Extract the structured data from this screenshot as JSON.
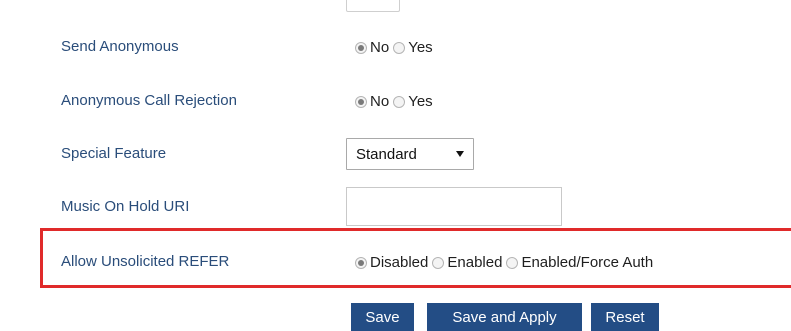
{
  "rows": {
    "send_anonymous": {
      "label": "Send Anonymous",
      "options": [
        "No",
        "Yes"
      ],
      "selected": "No"
    },
    "anonymous_call_rejection": {
      "label": "Anonymous Call Rejection",
      "options": [
        "No",
        "Yes"
      ],
      "selected": "No"
    },
    "special_feature": {
      "label": "Special Feature",
      "value": "Standard"
    },
    "music_on_hold_uri": {
      "label": "Music On Hold URI",
      "value": ""
    },
    "allow_unsolicited_refer": {
      "label": "Allow Unsolicited REFER",
      "options": [
        "Disabled",
        "Enabled",
        "Enabled/Force Auth"
      ],
      "selected": "Disabled"
    }
  },
  "buttons": {
    "save": "Save",
    "save_and_apply": "Save and Apply",
    "reset": "Reset"
  },
  "colors": {
    "label_text": "#2a4d7a",
    "button_bg": "#234d85",
    "highlight_border": "#e02a2a"
  }
}
